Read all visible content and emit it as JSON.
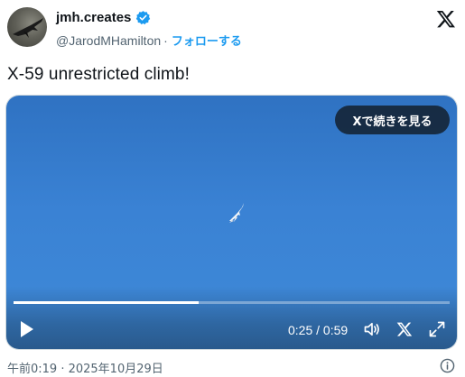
{
  "author": {
    "display_name": "jmh.creates",
    "handle": "@JarodMHamilton",
    "separator": "·",
    "follow_label": "フォローする",
    "verified": true,
    "avatar_icon": "jet-avatar-icon"
  },
  "tweet": {
    "text": "X-59 unrestricted climb!",
    "timestamp": "午前0:19 · 2025年10月29日"
  },
  "video": {
    "continue_label": "Xで続きを見る",
    "current_time": "0:25",
    "duration": "0:59",
    "time_display": "0:25 / 0:59",
    "progress_fraction": 0.424
  },
  "colors": {
    "accent": "#1d9bf0",
    "text": "#0f1419",
    "secondary": "#536471",
    "sky": "#3a82d4"
  },
  "icons": {
    "brand": "x-logo-icon",
    "verified": "verified-badge-icon",
    "play": "play-icon",
    "volume": "volume-icon",
    "brand_small": "x-logo-icon",
    "fullscreen": "fullscreen-icon",
    "info": "info-icon"
  }
}
